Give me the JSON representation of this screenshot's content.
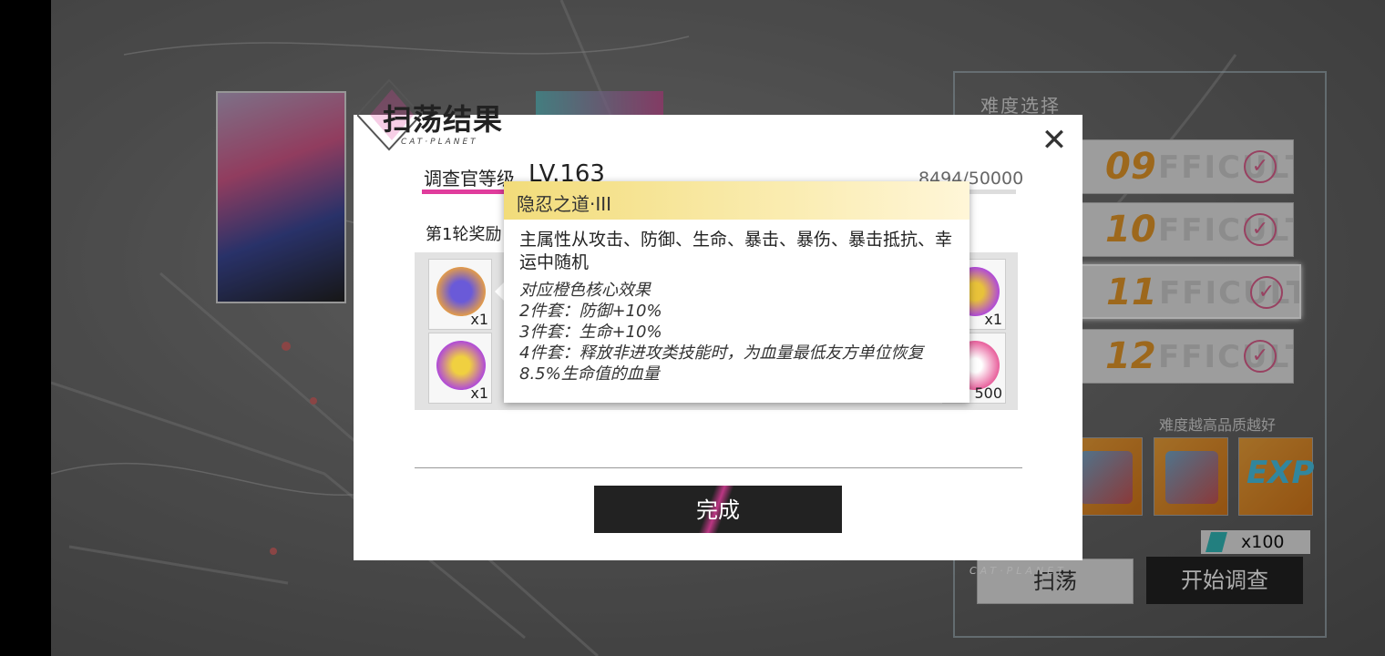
{
  "background": {
    "difficulty_title": "难度选择",
    "difficulties": [
      {
        "level": "09",
        "ghost": "FFICULTY",
        "selected": false
      },
      {
        "level": "10",
        "ghost": "FFICULTY",
        "selected": false
      },
      {
        "level": "11",
        "ghost": "FFICULTY",
        "selected": true
      },
      {
        "level": "12",
        "ghost": "FFICULTY",
        "selected": false
      }
    ],
    "check_glyph": "✓",
    "quality_note": "难度越高品质越好",
    "reward_exp_label": "EXP",
    "ticket_count": "x100",
    "sweep_button": "扫荡",
    "start_button": "开始调查",
    "brand_tag": "CAT·PLANET"
  },
  "dialog": {
    "title": "扫荡结果",
    "title_sub": "CAT·PLANET",
    "close_glyph": "✕",
    "investigator_label": "调查官等级",
    "level_value": "LV.163",
    "exp_text": "8494/50000",
    "exp_progress": 0.17,
    "round_label": "第1轮奖励",
    "items": [
      {
        "qty": "x1",
        "color": "#f0a33a"
      },
      {
        "qty": "x1",
        "color": "#b04ad8"
      },
      {
        "qty": "x1",
        "color": "#b04ad8"
      },
      {
        "qty": "500",
        "color": "#e8609c"
      }
    ],
    "done_button": "完成"
  },
  "tooltip": {
    "name": "隐忍之道·III",
    "main_stat": "主属性从攻击、防御、生命、暴击、暴伤、暴击抵抗、幸运中随机",
    "core_title": "对应橙色核心效果",
    "set2": "2件套：防御+10%",
    "set3": "3件套：生命+10%",
    "set4": "4件套：释放非进攻类技能时，为血量最低友方单位恢复8.5%生命值的血量"
  },
  "colors": {
    "accent": "#e03c9c",
    "tooltip_header": "#f2dc7a",
    "difficulty_number": "#e89a2a"
  }
}
